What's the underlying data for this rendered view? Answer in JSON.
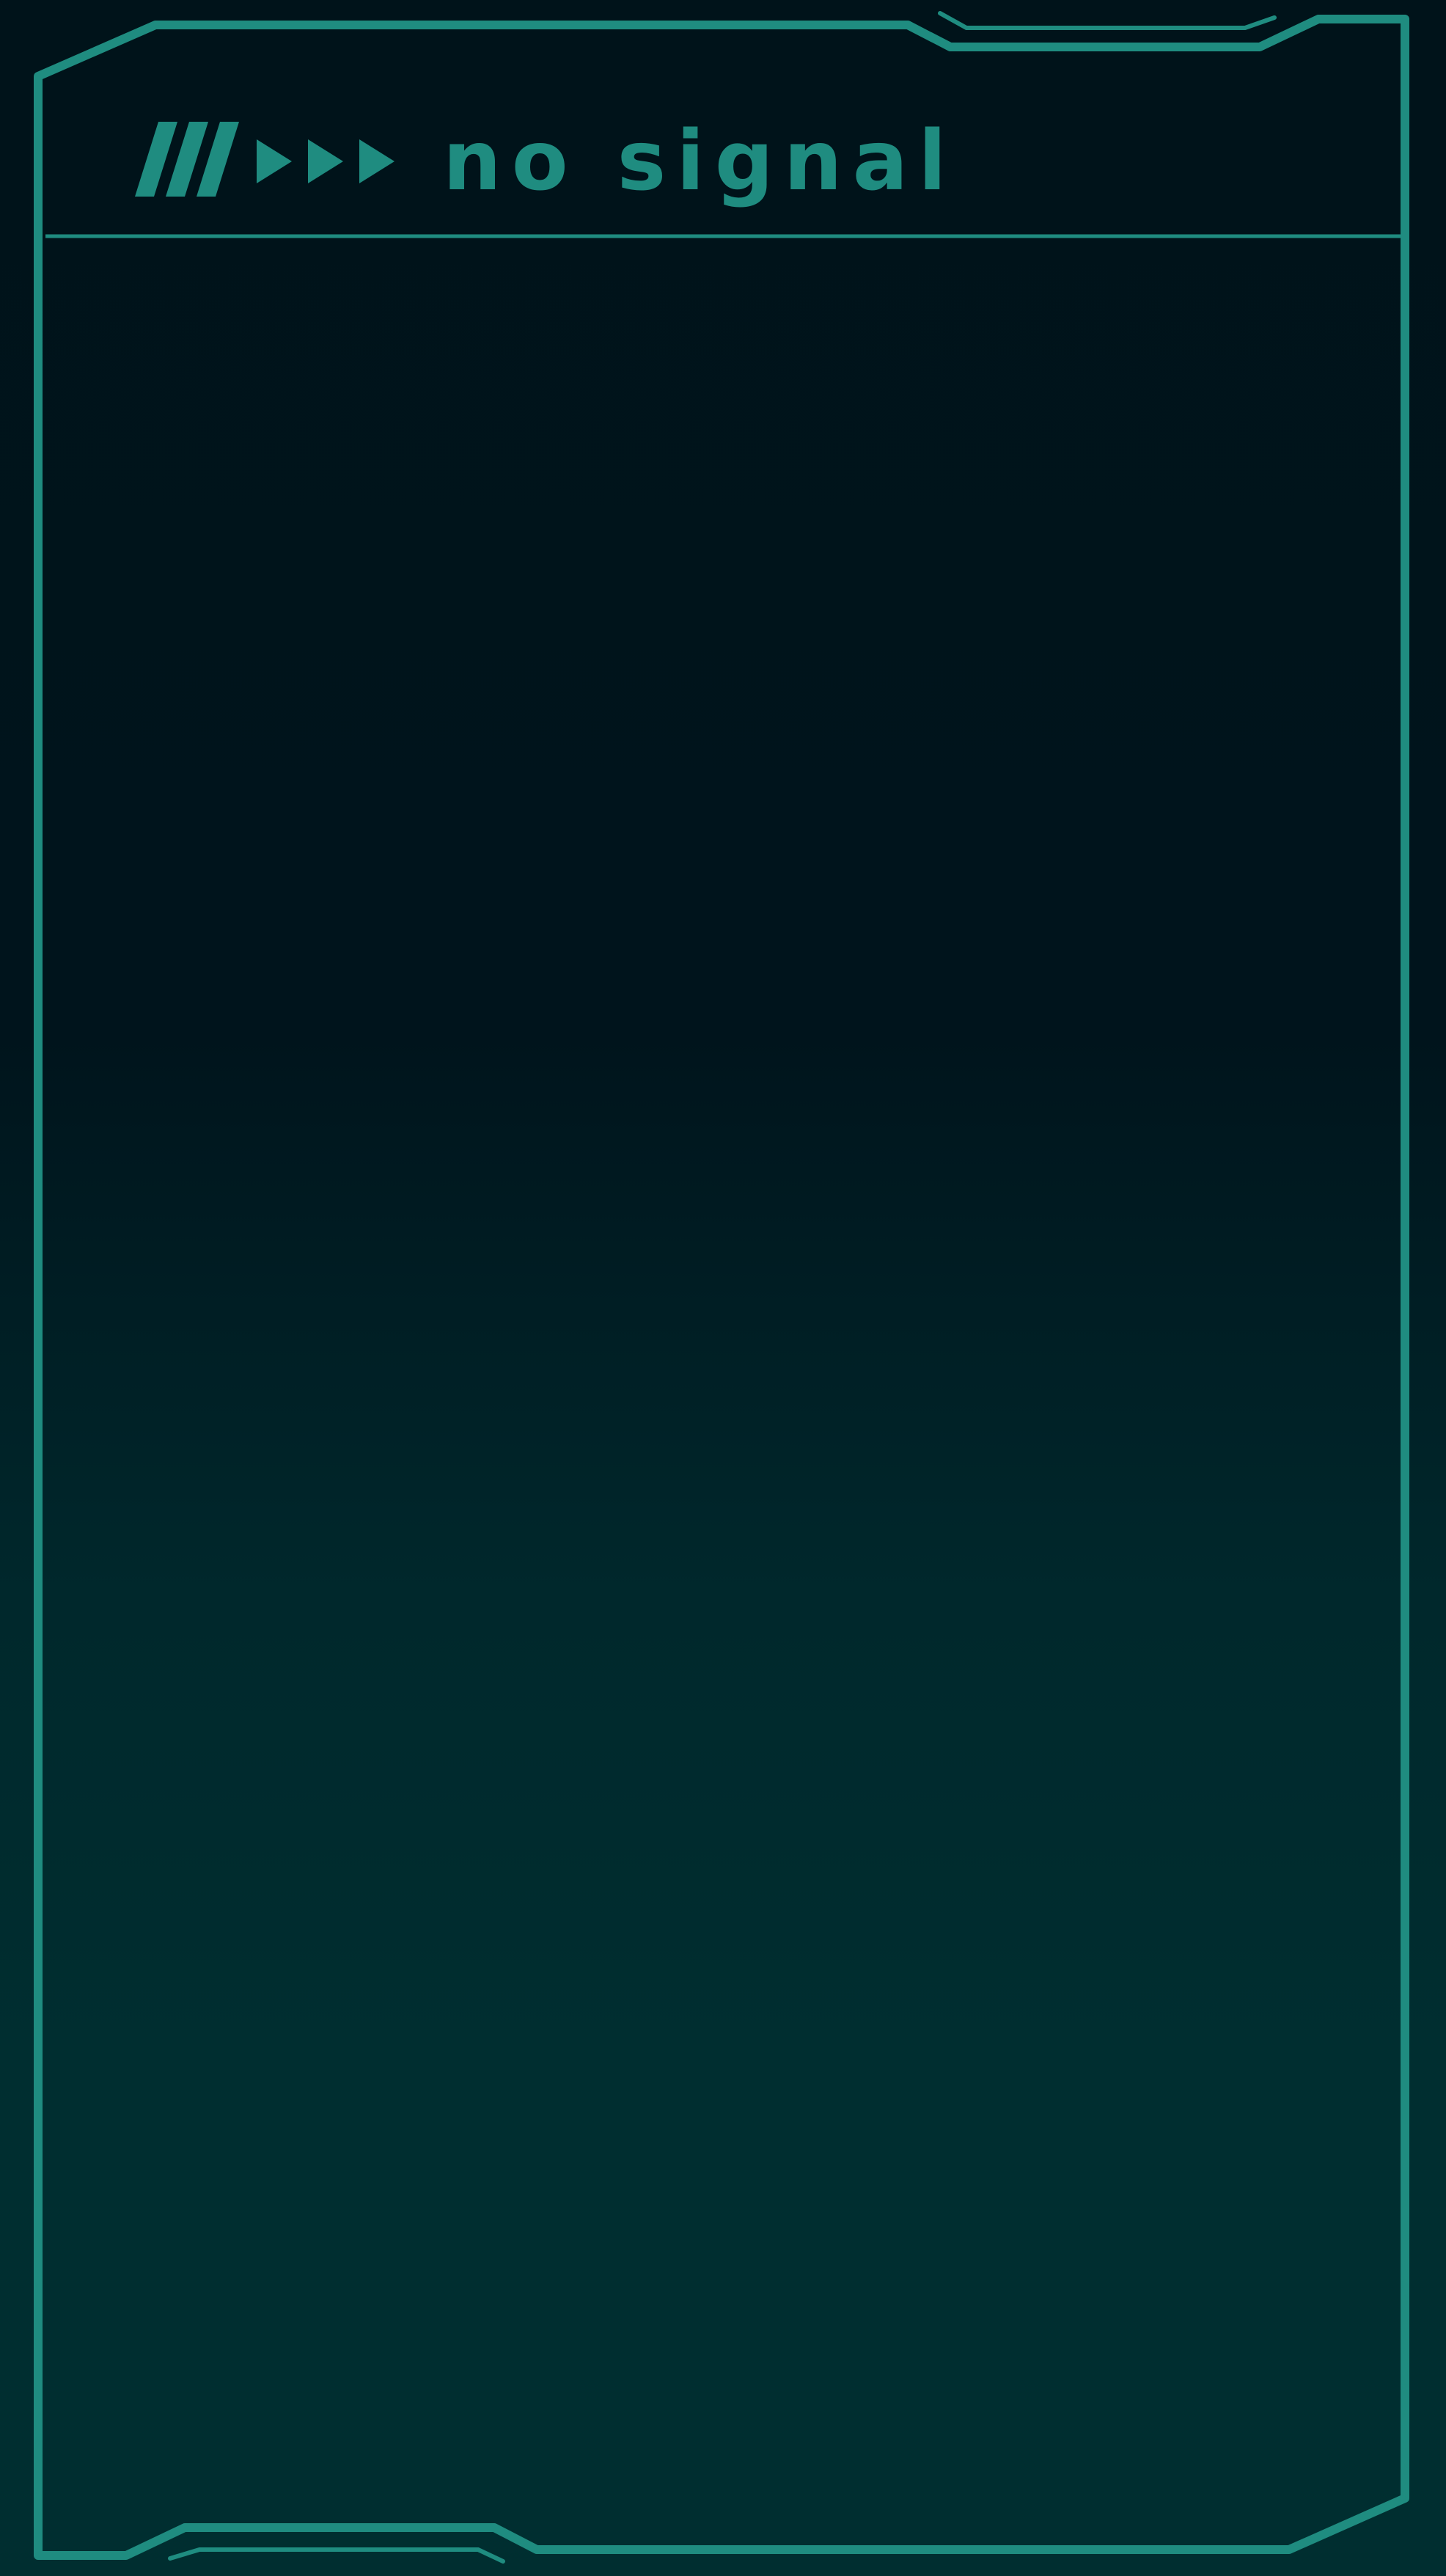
{
  "screen": {
    "title": "NO SIGNAL",
    "icons": {
      "slashes": "slash-stripes-icon",
      "arrows": "triple-play-arrow-icon"
    },
    "colors": {
      "accent": "#1f8c80",
      "background_top": "#00131a",
      "background_bottom": "#002e30"
    }
  }
}
